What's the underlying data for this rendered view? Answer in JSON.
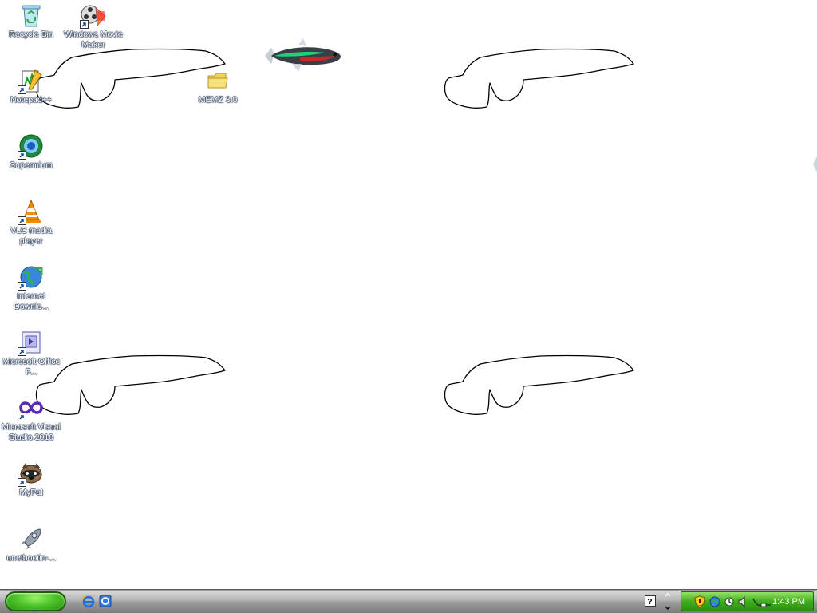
{
  "desktop": {
    "icons": [
      {
        "label": "Recycle Bin",
        "icon": "recycle-bin-icon",
        "shortcut": false
      },
      {
        "label": "Windows Movie Maker",
        "icon": "movie-maker-icon",
        "shortcut": true
      },
      {
        "label": "Notepad++",
        "icon": "notepad-plus-plus-icon",
        "shortcut": true
      },
      {
        "label": "MEMZ 3.0",
        "icon": "folder-icon",
        "shortcut": false
      },
      {
        "label": "Supermium",
        "icon": "supermium-browser-icon",
        "shortcut": true
      },
      {
        "label": "VLC media player",
        "icon": "vlc-cone-icon",
        "shortcut": true
      },
      {
        "label": "Internet Downlo...",
        "icon": "download-manager-globe-icon",
        "shortcut": true
      },
      {
        "label": "Microsoft Office F...",
        "icon": "office-frontpage-icon",
        "shortcut": true
      },
      {
        "label": "Microsoft Visual Studio 2010",
        "icon": "visual-studio-infinity-icon",
        "shortcut": true
      },
      {
        "label": "MyPal",
        "icon": "mypal-raccoon-icon",
        "shortcut": true
      },
      {
        "label": "unetbootin-...",
        "icon": "unetbootin-rocket-icon",
        "shortcut": false
      }
    ]
  },
  "taskbar": {
    "start_button": "start",
    "quick_launch": [
      "internet-explorer-icon",
      "outlook-express-icon"
    ],
    "tray_icons": [
      "help-icon",
      "show-hidden-icons-chevron",
      "security-shield-icon",
      "network-globe-icon",
      "connection-icon",
      "volume-icon",
      "usb-connection-icon"
    ],
    "clock": "1:43 PM"
  },
  "colors": {
    "desktop_background": "#ffffff",
    "start_green": "#4fc62a",
    "tray_green": "#3fae1c",
    "taskbar_gray": "#b4b4b4"
  }
}
